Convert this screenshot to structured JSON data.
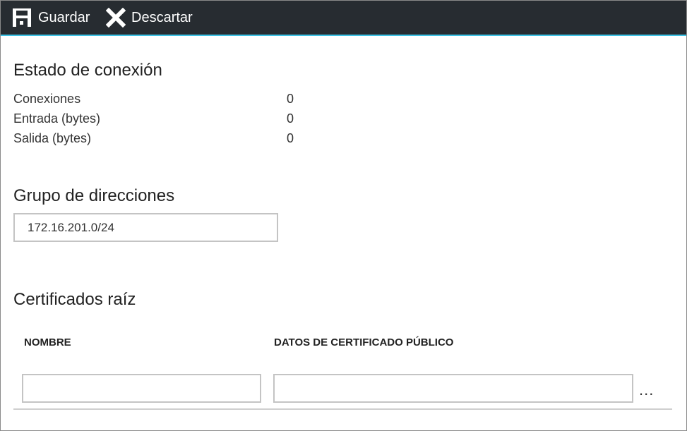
{
  "toolbar": {
    "save_label": "Guardar",
    "save_icon": "save-icon",
    "discard_label": "Descartar",
    "discard_icon": "close-icon",
    "background": "#272c31",
    "accent": "#3ec3e6"
  },
  "connection_status": {
    "title": "Estado de conexión",
    "rows": [
      {
        "label": "Conexiones",
        "value": "0"
      },
      {
        "label": "Entrada (bytes)",
        "value": "0"
      },
      {
        "label": "Salida (bytes)",
        "value": "0"
      }
    ]
  },
  "address_pool": {
    "title": "Grupo de direcciones",
    "value": "172.16.201.0/24"
  },
  "root_certificates": {
    "title": "Certificados raíz",
    "columns": [
      "NOMBRE",
      "DATOS DE CERTIFICADO PÚBLICO"
    ],
    "row": {
      "name": "",
      "data": ""
    },
    "more_label": "..."
  }
}
